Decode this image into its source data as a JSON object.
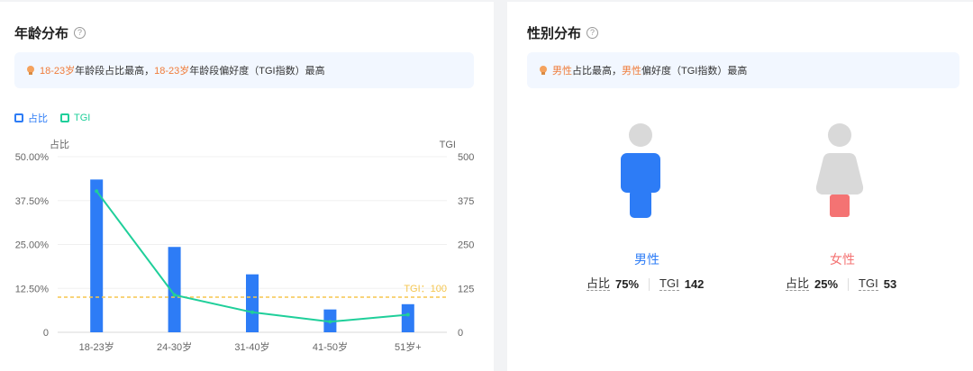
{
  "age_card": {
    "title": "年龄分布",
    "help_icon": "?",
    "tip": {
      "icon": "bulb-icon",
      "hl1": "18-23岁",
      "text1": "年龄段占比最高，",
      "hl2": "18-23岁",
      "text2": "年龄段偏好度（TGI指数）最高"
    },
    "legend": [
      {
        "label": "占比",
        "color": "#2d7cf6"
      },
      {
        "label": "TGI",
        "color": "#1fcf9a"
      }
    ]
  },
  "chart_data": {
    "type": "bar",
    "categories": [
      "18-23岁",
      "24-30岁",
      "31-40岁",
      "41-50岁",
      "51岁+"
    ],
    "series": [
      {
        "name": "占比",
        "type": "bar",
        "axis": "left",
        "values": [
          43.5,
          24.3,
          16.5,
          6.5,
          8.0
        ],
        "color": "#2d7cf6"
      },
      {
        "name": "TGI",
        "type": "line",
        "axis": "right",
        "values": [
          402,
          106,
          57,
          30,
          50
        ],
        "color": "#1fcf9a"
      }
    ],
    "ylabel": "占比",
    "ylabel_right": "TGI",
    "ylim": [
      0,
      50
    ],
    "ylim_right": [
      0,
      500
    ],
    "yticks": [
      "0",
      "12.50%",
      "25.00%",
      "37.50%",
      "50.00%"
    ],
    "yticks_right": [
      "0",
      "125",
      "250",
      "375",
      "500"
    ],
    "reference_line": {
      "label": "TGI：100",
      "value": 100,
      "color": "#f5c64f"
    },
    "grid": true
  },
  "gender_card": {
    "title": "性别分布",
    "help_icon": "?",
    "tip": {
      "icon": "bulb-icon",
      "hl1": "男性",
      "text1": "占比最高，",
      "hl2": "男性",
      "text2": "偏好度（TGI指数）最高"
    },
    "male": {
      "name": "男性",
      "ratio_label": "占比",
      "ratio": "75%",
      "tgi_label": "TGI",
      "tgi": "142",
      "color": "#2d7cf6",
      "icon": "male-figure-icon"
    },
    "female": {
      "name": "女性",
      "ratio_label": "占比",
      "ratio": "25%",
      "tgi_label": "TGI",
      "tgi": "53",
      "color": "#f47373",
      "icon": "female-figure-icon"
    }
  }
}
